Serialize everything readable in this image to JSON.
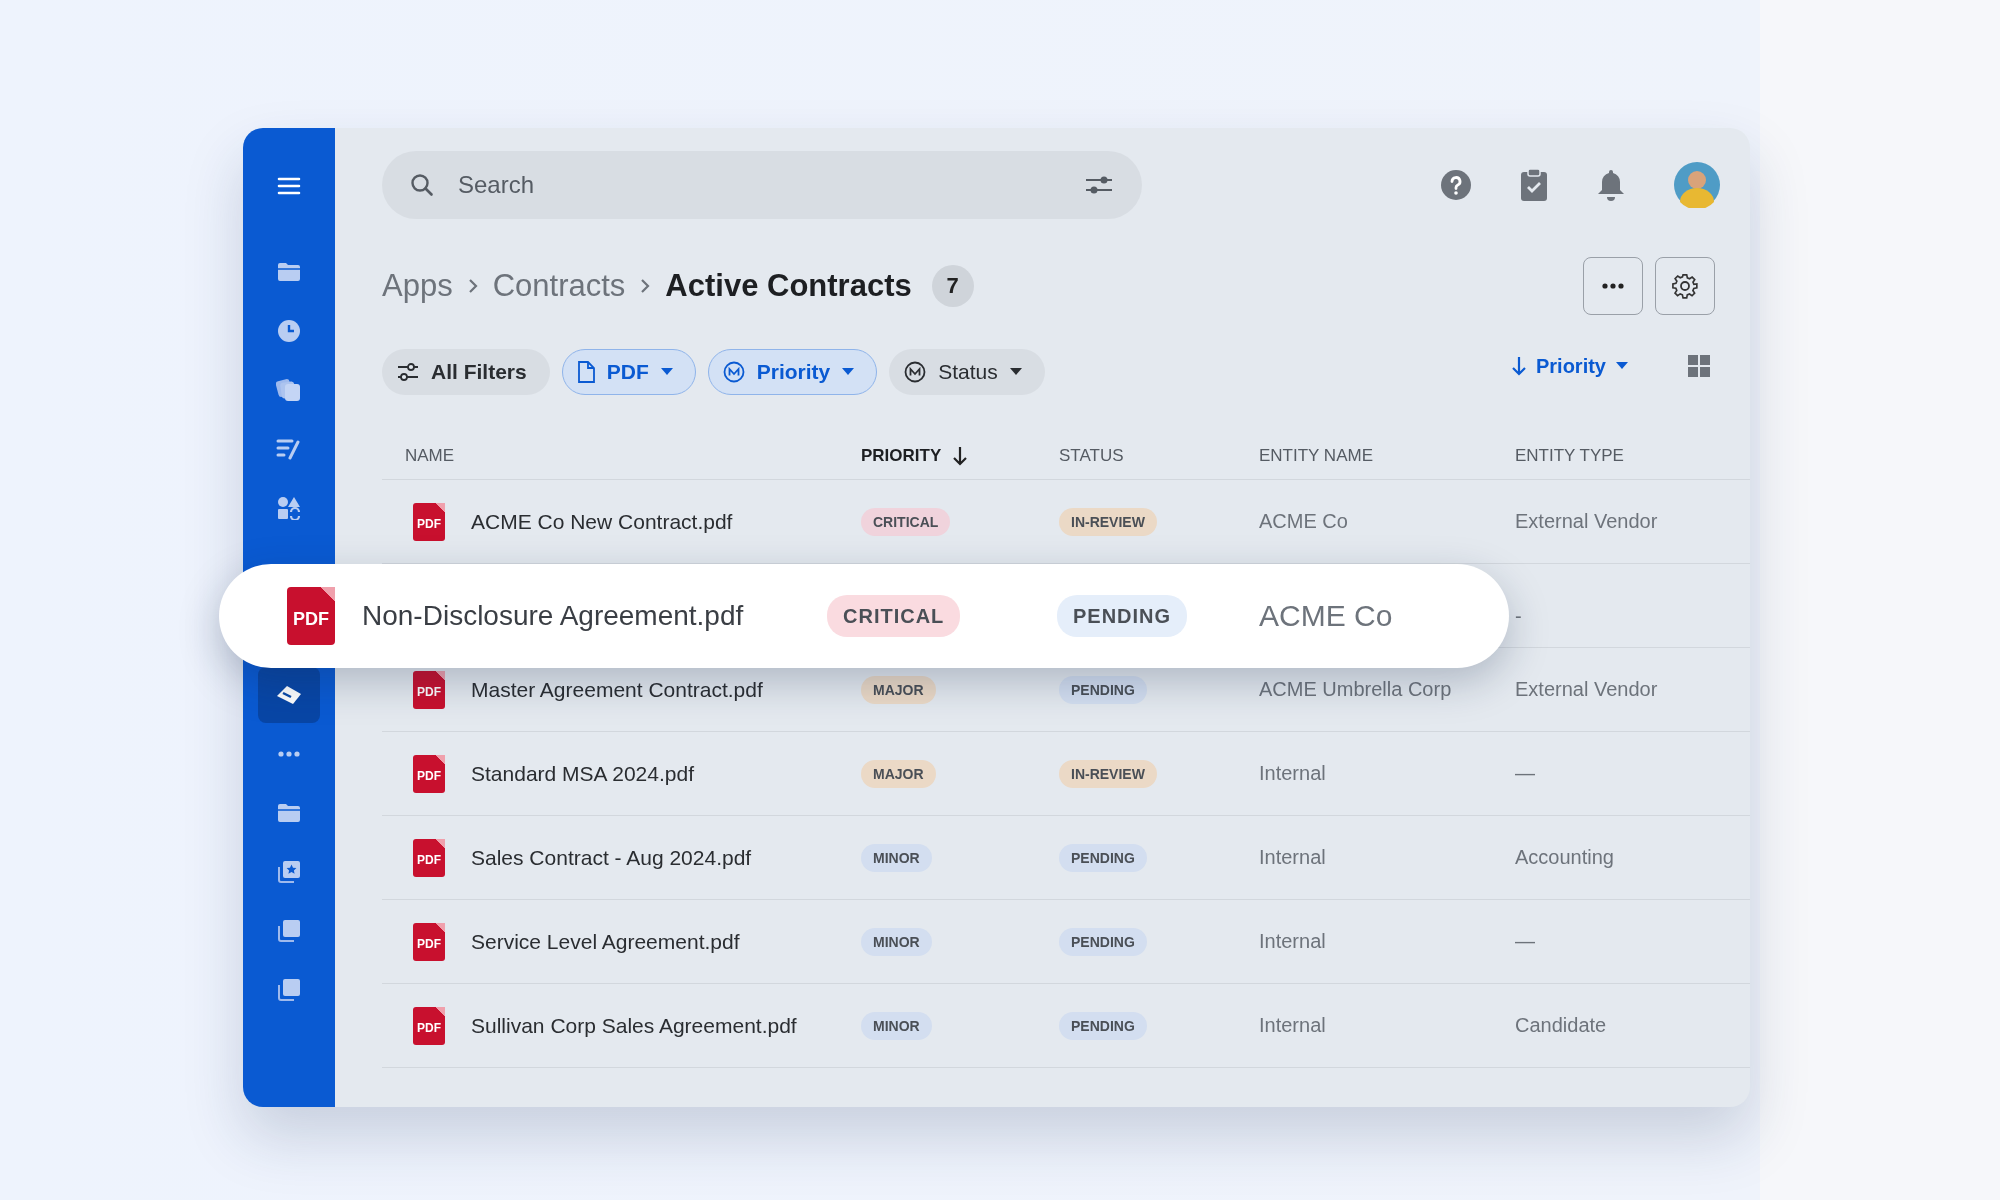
{
  "sidebar": {
    "top_items": [
      {
        "selected": false
      },
      {
        "selected": false
      },
      {
        "selected": false
      },
      {
        "selected": false
      },
      {
        "selected": false
      }
    ],
    "bottom_items": [
      {
        "selected": true
      },
      {
        "selected": false
      },
      {
        "selected": false
      },
      {
        "selected": false
      },
      {
        "selected": false
      },
      {
        "selected": false
      }
    ]
  },
  "search": {
    "placeholder": "Search"
  },
  "breadcrumb": [
    "Apps",
    "Contracts",
    "Active Contracts"
  ],
  "count": "7",
  "filters": [
    {
      "label": "All Filters",
      "kind": "all",
      "active": false
    },
    {
      "label": "PDF",
      "kind": "type",
      "active": true
    },
    {
      "label": "Priority",
      "kind": "field",
      "active": true
    },
    {
      "label": "Status",
      "kind": "field",
      "active": false
    }
  ],
  "sort": {
    "label": "Priority"
  },
  "table": {
    "columns": [
      {
        "label": "NAME",
        "sorted": false
      },
      {
        "label": "PRIORITY",
        "sorted": true
      },
      {
        "label": "STATUS",
        "sorted": false
      },
      {
        "label": "ENTITY NAME",
        "sorted": false
      },
      {
        "label": "ENTITY TYPE",
        "sorted": false
      }
    ],
    "rows": [
      {
        "icon_label": "PDF",
        "name": "ACME Co New Contract.pdf",
        "priority": {
          "label": "CRITICAL",
          "color": "#f0d3dc"
        },
        "status": {
          "label": "IN-REVIEW",
          "color": "#ebd9c6"
        },
        "entity_name": "ACME Co",
        "entity_type": "External Vendor",
        "highlighted": false
      },
      {
        "icon_label": "PDF",
        "name": "Non-Disclosure Agreement.pdf",
        "priority": {
          "label": "CRITICAL",
          "color": "#fadbe0"
        },
        "status": {
          "label": "PENDING",
          "color": "#e5eefa"
        },
        "entity_name": "ACME Co",
        "entity_type": "-",
        "highlighted": true
      },
      {
        "icon_label": "PDF",
        "name": "Master Agreement Contract.pdf",
        "priority": {
          "label": "MAJOR",
          "color": "#ebd9c6"
        },
        "status": {
          "label": "PENDING",
          "color": "#d3def0"
        },
        "entity_name": "ACME Umbrella Corp",
        "entity_type": "External Vendor",
        "highlighted": false
      },
      {
        "icon_label": "PDF",
        "name": "Standard MSA 2024.pdf",
        "priority": {
          "label": "MAJOR",
          "color": "#ebd9c6"
        },
        "status": {
          "label": "IN-REVIEW",
          "color": "#ebd9c6"
        },
        "entity_name": "Internal",
        "entity_type": "—",
        "highlighted": false
      },
      {
        "icon_label": "PDF",
        "name": "Sales Contract - Aug 2024.pdf",
        "priority": {
          "label": "MINOR",
          "color": "#d3def0"
        },
        "status": {
          "label": "PENDING",
          "color": "#d3def0"
        },
        "entity_name": "Internal",
        "entity_type": "Accounting",
        "highlighted": false
      },
      {
        "icon_label": "PDF",
        "name": "Service Level Agreement.pdf",
        "priority": {
          "label": "MINOR",
          "color": "#d3def0"
        },
        "status": {
          "label": "PENDING",
          "color": "#d3def0"
        },
        "entity_name": "Internal",
        "entity_type": "—",
        "highlighted": false
      },
      {
        "icon_label": "PDF",
        "name": "Sullivan Corp Sales Agreement.pdf",
        "priority": {
          "label": "MINOR",
          "color": "#d3def0"
        },
        "status": {
          "label": "PENDING",
          "color": "#d3def0"
        },
        "entity_name": "Internal",
        "entity_type": "Candidate",
        "highlighted": false
      }
    ]
  }
}
